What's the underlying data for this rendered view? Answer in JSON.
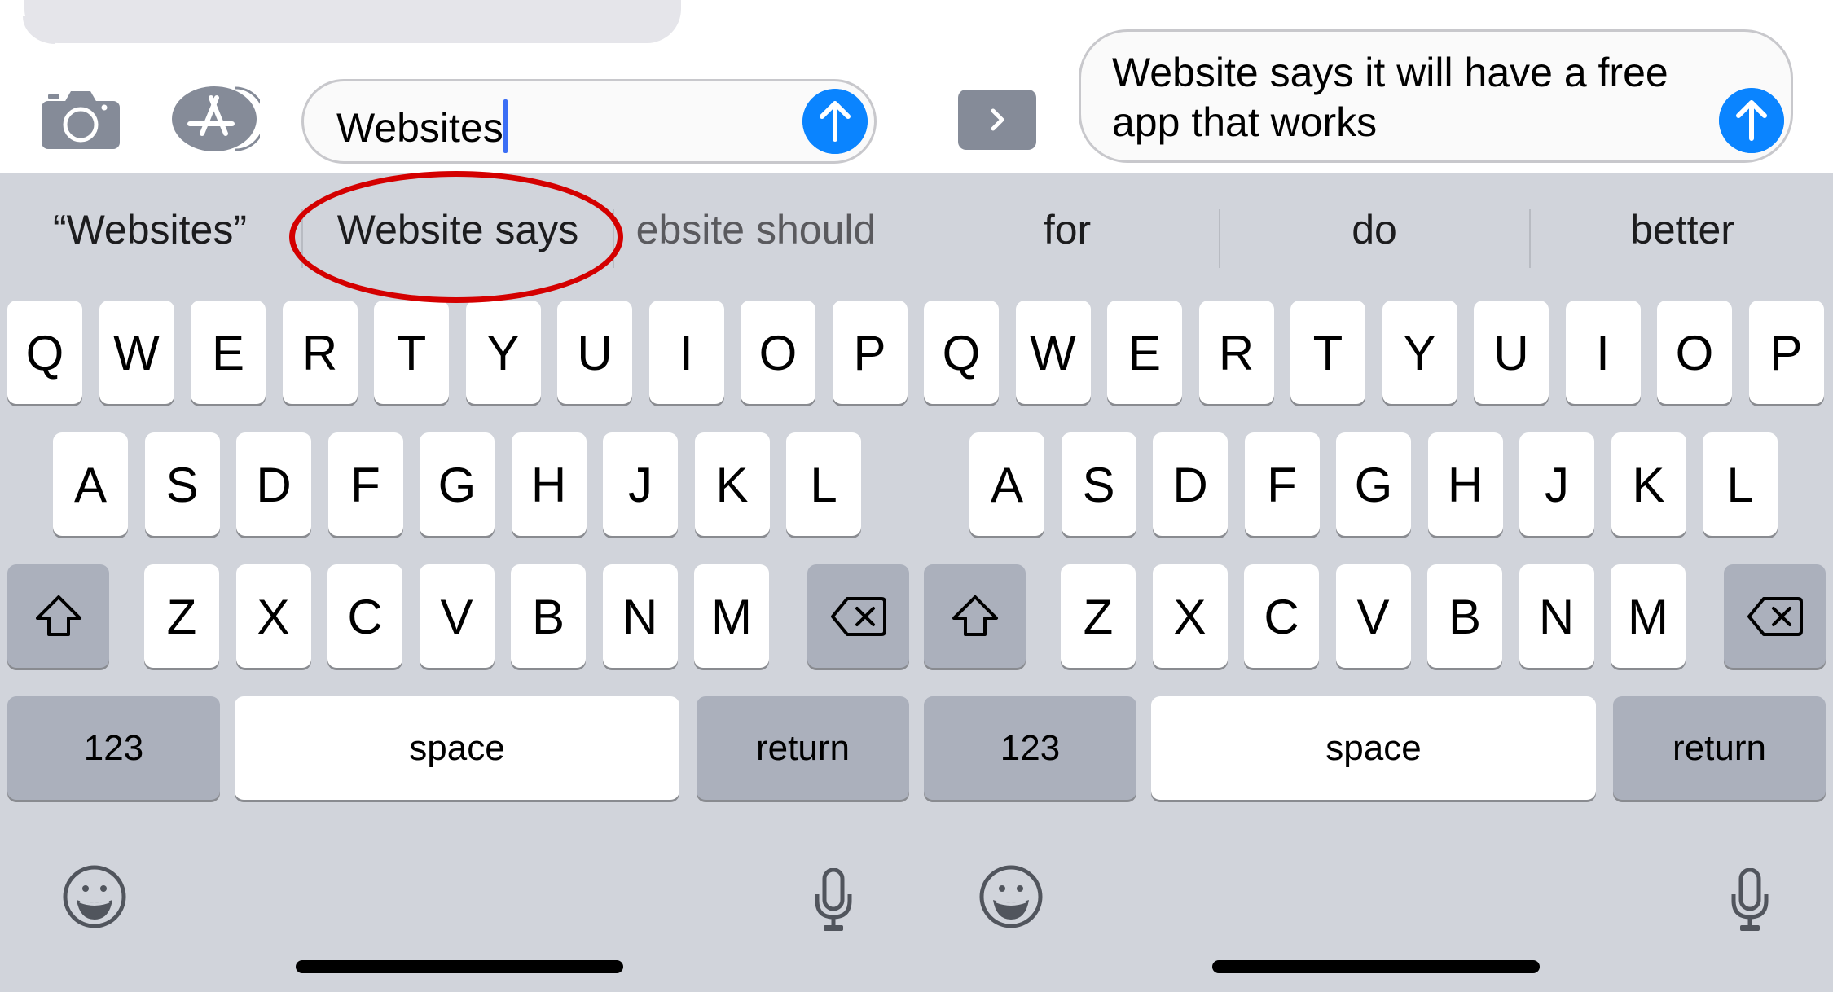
{
  "left_panel": {
    "input": {
      "value": "Websites",
      "has_caret": true
    },
    "toolbar": {
      "camera_icon": "camera-icon",
      "appstore_icon": "app-store-icon"
    },
    "suggestions": [
      {
        "label": "“Websites”"
      },
      {
        "label": "Website says",
        "highlighted": true
      },
      {
        "label": "ebsite should"
      }
    ]
  },
  "right_panel": {
    "input": {
      "value": "Website says it will have a free\napp that works"
    },
    "toolbar": {
      "expand_icon": "chevron-right-icon"
    },
    "suggestions": [
      {
        "label": "for"
      },
      {
        "label": "do"
      },
      {
        "label": "better"
      }
    ]
  },
  "keyboard": {
    "row1": [
      "Q",
      "W",
      "E",
      "R",
      "T",
      "Y",
      "U",
      "I",
      "O",
      "P"
    ],
    "row2": [
      "A",
      "S",
      "D",
      "F",
      "G",
      "H",
      "J",
      "K",
      "L"
    ],
    "row3": [
      "Z",
      "X",
      "C",
      "V",
      "B",
      "N",
      "M"
    ],
    "numbers_label": "123",
    "space_label": "space",
    "return_label": "return",
    "shift_icon": "shift-icon",
    "delete_icon": "delete-icon",
    "emoji_icon": "emoji-icon",
    "mic_icon": "microphone-icon"
  },
  "annotation": {
    "color": "#d40000",
    "target": "Website says"
  },
  "colors": {
    "accent": "#0a84ff",
    "keyboard_bg": "#d1d4db",
    "function_key": "#abb0bc",
    "caret": "#3b6ef5"
  }
}
